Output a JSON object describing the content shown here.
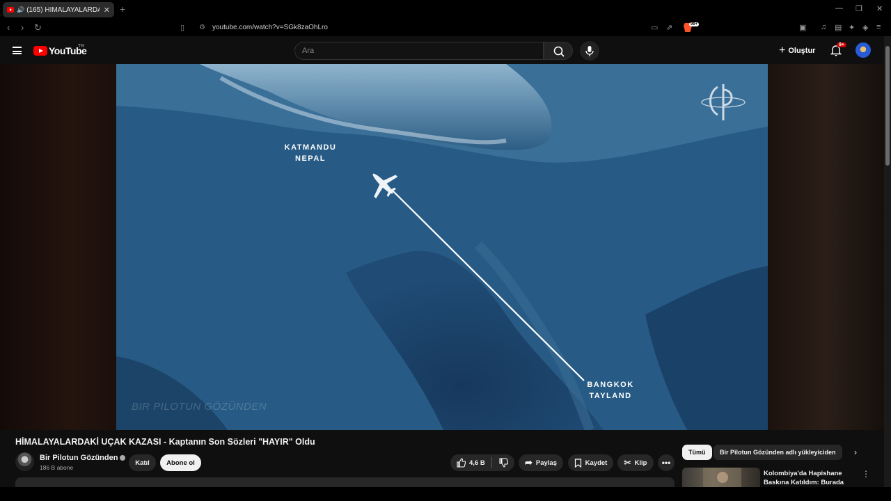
{
  "browser": {
    "tab_title": "(165) HİMALAYALARDAKİ UÇA",
    "url": "youtube.com/watch?v=SGk8zaOhLro",
    "brave_badge": "99+"
  },
  "header": {
    "logo_text": "YouTube",
    "country": "TR",
    "search_placeholder": "Ara",
    "create_label": "Oluştur",
    "notification_badge": "9+"
  },
  "video": {
    "overlay_origin_city": "KATMANDU",
    "overlay_origin_country": "NEPAL",
    "overlay_dest_city": "BANGKOK",
    "overlay_dest_country": "TAYLAND",
    "watermark": "BIR PILOTUN GÖZÜNDEN",
    "title": "HİMALAYALARDAKİ UÇAK KAZASI - Kaptanın Son Sözleri \"HAYIR\" Oldu"
  },
  "channel": {
    "name": "Bir Pilotun Gözünden",
    "subscribers": "186 B abone",
    "join_label": "Katıl",
    "subscribe_label": "Abone ol"
  },
  "actions": {
    "likes": "4,6 B",
    "share_label": "Paylaş",
    "save_label": "Kaydet",
    "clip_label": "Klip"
  },
  "sidebar": {
    "chips": [
      "Tümü",
      "Bir Pilotun Gözünden adlı yükleyiciden"
    ],
    "recommended_title": "Kolombiya'da Hapishane Baskına Katıldım: Burada"
  }
}
